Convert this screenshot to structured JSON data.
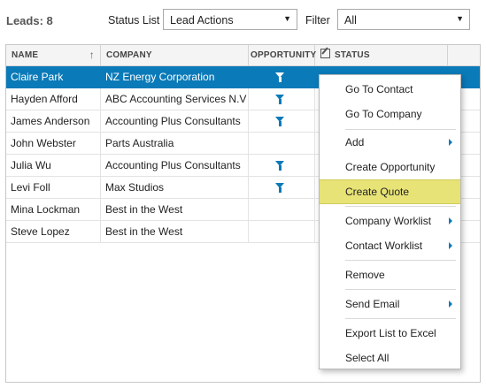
{
  "toolbar": {
    "leads_label": "Leads: 8",
    "status_list_label": "Status List",
    "status_list_value": "Lead Actions",
    "filter_label": "Filter",
    "filter_value": "All"
  },
  "grid": {
    "columns": {
      "name": "NAME",
      "company": "COMPANY",
      "opportunity": "OPPORTUNITY",
      "status": "STATUS"
    },
    "sort_column": "NAME",
    "sort_direction": "ascending",
    "rows": [
      {
        "name": "Claire Park",
        "company": "NZ Energy Corporation",
        "opportunity": true
      },
      {
        "name": "Hayden Afford",
        "company": "ABC Accounting Services N.V",
        "opportunity": true
      },
      {
        "name": "James Anderson",
        "company": "Accounting Plus Consultants",
        "opportunity": true
      },
      {
        "name": "John Webster",
        "company": "Parts Australia",
        "opportunity": false
      },
      {
        "name": "Julia Wu",
        "company": "Accounting Plus Consultants",
        "opportunity": true
      },
      {
        "name": "Levi Foll",
        "company": "Max Studios",
        "opportunity": true
      },
      {
        "name": "Mina Lockman",
        "company": "Best in the West",
        "opportunity": false
      },
      {
        "name": "Steve Lopez",
        "company": "Best in the West",
        "opportunity": false
      }
    ],
    "selected_row": 0
  },
  "context_menu": {
    "items": [
      {
        "label": "Go To Contact"
      },
      {
        "label": "Go To Company"
      },
      {
        "label": "Add",
        "submenu": true
      },
      {
        "label": "Create Opportunity"
      },
      {
        "label": "Create Quote",
        "highlighted": true
      },
      {
        "label": "Company Worklist",
        "submenu": true
      },
      {
        "label": "Contact Worklist",
        "submenu": true
      },
      {
        "label": "Remove"
      },
      {
        "label": "Send Email",
        "submenu": true
      },
      {
        "label": "Export List to Excel"
      },
      {
        "label": "Select All"
      }
    ]
  },
  "colors": {
    "accent": "#0a7ab8",
    "highlight": "#e7e376"
  }
}
